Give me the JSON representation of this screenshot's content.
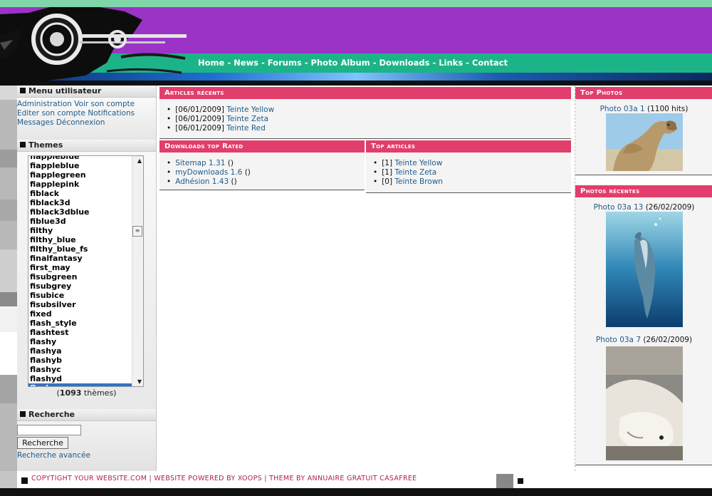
{
  "header": {
    "nav": [
      "Home",
      "News",
      "Forums",
      "Photo Album",
      "Downloads",
      "Links",
      "Contact"
    ],
    "nav_separator": "-"
  },
  "colors": {
    "purple": "#9b33c6",
    "teal": "#1db388",
    "pink_title": "#e23e6b",
    "link": "#1f5a8a"
  },
  "user_menu": {
    "title": "Menu utilisateur",
    "links": [
      "Administration",
      "Voir son compte",
      "Editer son compte",
      "Notifications",
      "Messages",
      "Déconnexion"
    ]
  },
  "themes": {
    "title": "Themes",
    "partial_item": "fiappleblue",
    "items": [
      "fiappleblue",
      "fiapplegreen",
      "fiapplepink",
      "fiblack",
      "fiblack3d",
      "fiblack3dblue",
      "fiblue3d",
      "filthy",
      "filthy_blue",
      "filthy_blue_fs",
      "finalfantasy",
      "first_may",
      "fisubgreen",
      "fisubgrey",
      "fisubice",
      "fisubsilver",
      "fixed",
      "flash_style",
      "flashtest",
      "flashy",
      "flashya",
      "flashyb",
      "flashyc",
      "flashyd",
      "flashye"
    ],
    "selected": "flashye",
    "count": "1093",
    "count_suffix": " thèmes)",
    "count_prefix": "("
  },
  "search": {
    "title": "Recherche",
    "button": "Recherche",
    "advanced": "Recherche avancée",
    "value": ""
  },
  "articles_recent": {
    "title": "Articles récents",
    "items": [
      {
        "date": "[06/01/2009]",
        "link": "Teinte Yellow"
      },
      {
        "date": "[06/01/2009]",
        "link": "Teinte Zeta"
      },
      {
        "date": "[06/01/2009]",
        "link": "Teinte Red"
      }
    ]
  },
  "downloads_top": {
    "title": "Downloads top Rated",
    "items": [
      {
        "link": "Sitemap 1.31",
        "suffix": " ()"
      },
      {
        "link": "myDownloads 1.6",
        "suffix": " ()"
      },
      {
        "link": "Adhésion 1.43",
        "suffix": " ()"
      }
    ]
  },
  "top_articles": {
    "title": "Top articles",
    "items": [
      {
        "count": "[1]",
        "link": "Teinte Yellow"
      },
      {
        "count": "[1]",
        "link": "Teinte Zeta"
      },
      {
        "count": "[0]",
        "link": "Teinte Brown"
      }
    ]
  },
  "top_photos": {
    "title": "Top Photos",
    "items": [
      {
        "link": "Photo 03a 1",
        "info": " (1100 hits)",
        "image": "camel"
      }
    ]
  },
  "recent_photos": {
    "title": "Photos récentes",
    "items": [
      {
        "link": "Photo 03a 13",
        "info": " (26/02/2009)",
        "image": "dolphin"
      },
      {
        "link": "Photo 03a 7",
        "info": " (26/02/2009)",
        "image": "polar-bear"
      }
    ]
  },
  "footer": {
    "text": "COPYTIGHT YOUR WEBSITE.COM | WEBSITE POWERED BY XOOPS | THEME BY ANNUAIRE GRATUIT CASAFREE"
  }
}
